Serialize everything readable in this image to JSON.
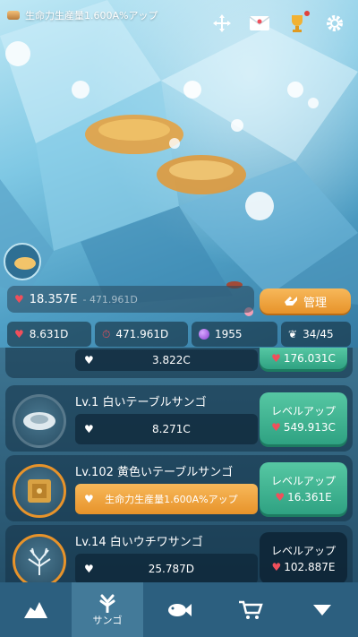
{
  "banner": {
    "text": "生命力生産量1.600A%アップ"
  },
  "top_icons": [
    "move-icon",
    "mail-icon",
    "trophy-icon",
    "gear-icon"
  ],
  "stats": {
    "life": "18.357E",
    "life_per": "471.961D",
    "manage_label": "管理",
    "tap_value": "8.631D",
    "time_value": "471.961D",
    "pearls": "1955",
    "fish_count": "34/45"
  },
  "list": {
    "partial_top": {
      "value": "3.822C",
      "cost": "176.031C"
    },
    "items": [
      {
        "title": "Lv.1 白いテーブルサンゴ",
        "value": "8.271C",
        "button": "レベルアップ",
        "cost": "549.913C",
        "style": "green"
      },
      {
        "title": "Lv.102 黄色いテーブルサンゴ",
        "value": "生命力生産量1.600A%アップ",
        "button": "レベルアップ",
        "cost": "16.361E",
        "style": "green",
        "bonus": true
      },
      {
        "title": "Lv.14 白いウチワサンゴ",
        "value": "25.787D",
        "button": "レベルアップ",
        "cost": "102.887E",
        "style": "dark"
      }
    ]
  },
  "nav": {
    "items": [
      {
        "icon": "rock-icon",
        "label": ""
      },
      {
        "icon": "coral-icon",
        "label": "サンゴ"
      },
      {
        "icon": "fish-icon",
        "label": ""
      },
      {
        "icon": "cart-icon",
        "label": ""
      },
      {
        "icon": "chevron-down-icon",
        "label": ""
      }
    ]
  },
  "colors": {
    "orange": "#e7932a",
    "green": "#2fa282",
    "heart": "#f04f5b"
  }
}
